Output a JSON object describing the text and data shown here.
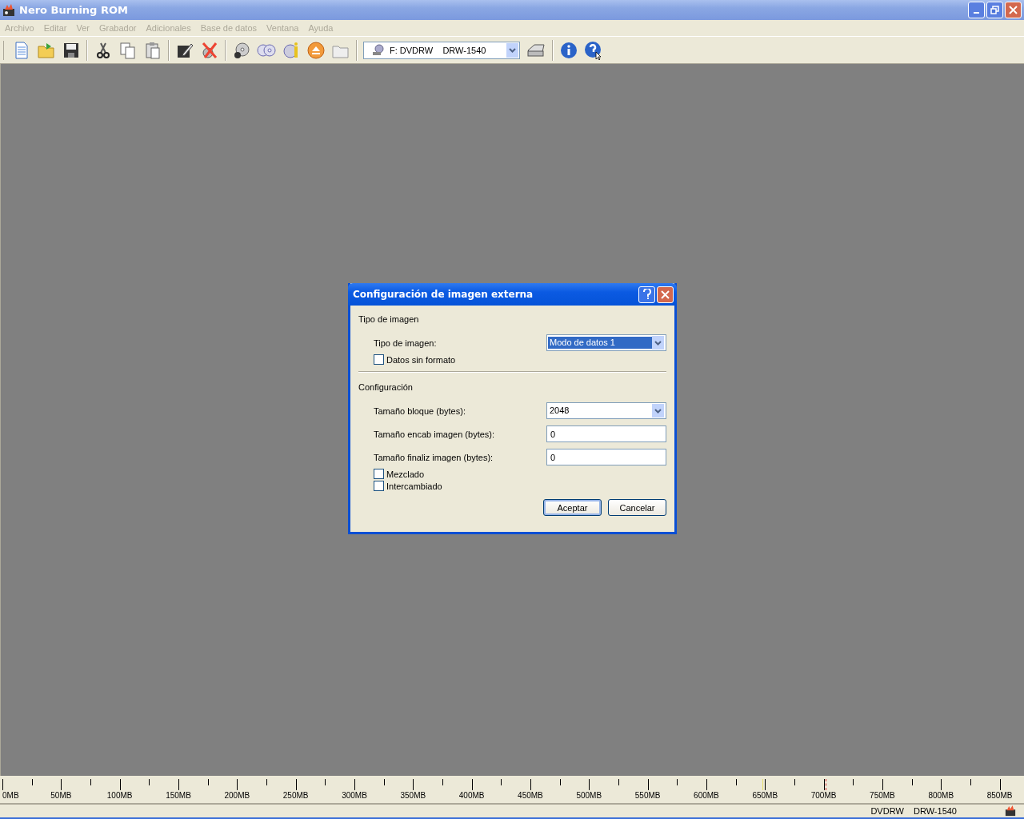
{
  "window": {
    "title": "Nero Burning ROM"
  },
  "menu": [
    {
      "label": "Archivo",
      "disabled": true
    },
    {
      "label": "Editar",
      "disabled": true
    },
    {
      "label": "Ver",
      "disabled": true
    },
    {
      "label": "Grabador",
      "disabled": true
    },
    {
      "label": "Adicionales",
      "disabled": true
    },
    {
      "label": "Base de datos",
      "disabled": true
    },
    {
      "label": "Ventana",
      "disabled": true
    },
    {
      "label": "Ayuda",
      "disabled": true
    }
  ],
  "toolbar": {
    "drive_select": {
      "value": "F: DVDRW    DRW-1540"
    }
  },
  "dialog": {
    "title": "Configuración de imagen externa",
    "sections": [
      {
        "heading": "Tipo de imagen",
        "fields": [
          {
            "kind": "select",
            "label": "Tipo de imagen:",
            "value": "Modo de datos 1",
            "highlighted": true
          },
          {
            "kind": "checkbox",
            "label": "Datos sin formato",
            "checked": false
          }
        ]
      },
      {
        "heading": "Configuración",
        "fields": [
          {
            "kind": "select",
            "label": "Tamaño bloque (bytes):",
            "value": "2048",
            "highlighted": false
          },
          {
            "kind": "text",
            "label": "Tamaño encab imagen (bytes):",
            "value": "0"
          },
          {
            "kind": "text",
            "label": "Tamaño finaliz imagen (bytes):",
            "value": "0"
          },
          {
            "kind": "checkbox",
            "label": "Mezclado",
            "checked": false
          },
          {
            "kind": "checkbox",
            "label": "Intercambiado",
            "checked": false
          }
        ]
      }
    ],
    "buttons": [
      {
        "label": "Aceptar",
        "default": true
      },
      {
        "label": "Cancelar",
        "default": false
      }
    ]
  },
  "ruler": {
    "labels": [
      "0MB",
      "50MB",
      "100MB",
      "150MB",
      "200MB",
      "250MB",
      "300MB",
      "350MB",
      "400MB",
      "450MB",
      "500MB",
      "550MB",
      "600MB",
      "650MB",
      "700MB",
      "750MB",
      "800MB",
      "850MB"
    ]
  },
  "status_bar": {
    "drive": "DVDRW    DRW-1540"
  }
}
